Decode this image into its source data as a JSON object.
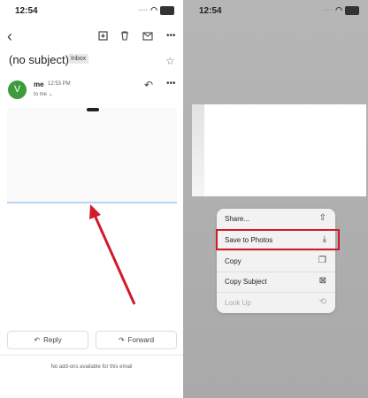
{
  "left": {
    "status": {
      "time": "12:54"
    },
    "subject": "(no subject)",
    "badge": "Inbox",
    "sender": {
      "initial": "V",
      "name": "me",
      "time": "12:53 PM",
      "to": "to me"
    },
    "reply_button": "Reply",
    "forward_button": "Forward",
    "addons_text": "No add-ons available for this email"
  },
  "right": {
    "status": {
      "time": "12:54"
    },
    "menu": [
      {
        "label": "Share...",
        "icon": "share-icon"
      },
      {
        "label": "Save to Photos",
        "icon": "save-photos-icon"
      },
      {
        "label": "Copy",
        "icon": "copy-icon"
      },
      {
        "label": "Copy Subject",
        "icon": "copy-subject-icon"
      },
      {
        "label": "Look Up",
        "icon": "look-up-icon"
      }
    ]
  },
  "colors": {
    "avatar": "#3c9b3c",
    "highlight": "#d11b2b",
    "arrow": "#d11b2b"
  }
}
